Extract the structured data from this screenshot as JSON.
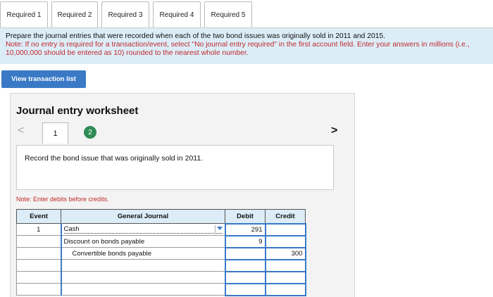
{
  "tabs": [
    {
      "label": "Required 1",
      "active": true
    },
    {
      "label": "Required 2"
    },
    {
      "label": "Required 3"
    },
    {
      "label": "Required 4"
    },
    {
      "label": "Required 5"
    }
  ],
  "instructions": {
    "main": "Prepare the journal entries that were recorded when each of the two bond issues was originally sold in 2011 and 2015.",
    "note": "Note: If no entry is required for a transaction/event, select \"No journal entry required\" in the first account field. Enter your answers in millions (i.e., 10,000,000 should be entered as 10) rounded to the nearest whole number."
  },
  "view_button": "View transaction list",
  "worksheet": {
    "title": "Journal entry worksheet",
    "nav_prev": "<",
    "nav_next": ">",
    "pages": [
      "1",
      "2"
    ],
    "record_text": "Record the bond issue that was originally sold in 2011.",
    "debit_note": "Note: Enter debits before credits."
  },
  "journal": {
    "headers": [
      "Event",
      "General Journal",
      "Debit",
      "Credit"
    ],
    "rows": [
      {
        "event": "1",
        "account": "Cash",
        "debit": "291",
        "credit": ""
      },
      {
        "event": "",
        "account": "Discount on bonds payable",
        "debit": "9",
        "credit": ""
      },
      {
        "event": "",
        "account": "Convertible bonds payable",
        "debit": "",
        "credit": "300"
      },
      {
        "event": "",
        "account": "",
        "debit": "",
        "credit": ""
      },
      {
        "event": "",
        "account": "",
        "debit": "",
        "credit": ""
      },
      {
        "event": "",
        "account": "",
        "debit": "",
        "credit": ""
      }
    ]
  },
  "colors": {
    "accent": "#3a79c6",
    "note_red": "#c0292b",
    "light_blue": "#dcedf8",
    "page_green": "#2e8b57"
  }
}
